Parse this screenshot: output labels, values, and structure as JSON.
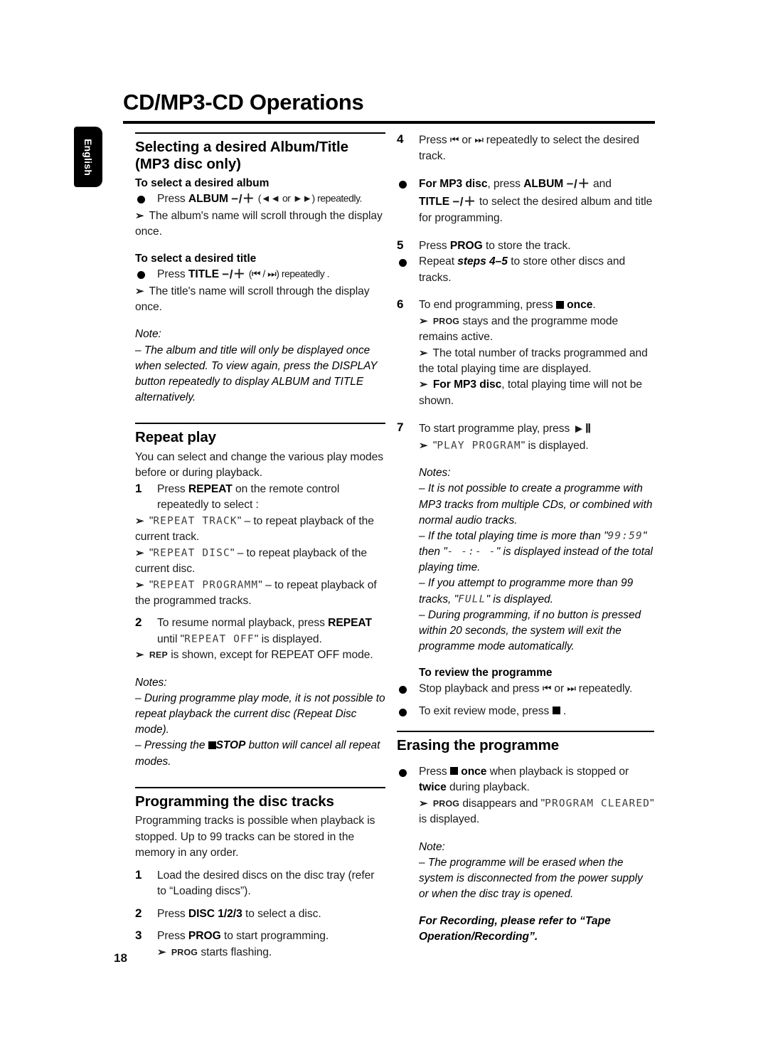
{
  "header": {
    "title": "CD/MP3-CD Operations",
    "language_tab": "English"
  },
  "page_number": "18",
  "left_column": {
    "section1": {
      "title": "Selecting a desired Album/Title (MP3 disc only)",
      "sub1_title": "To select a desired album",
      "sub1_press": "Press",
      "sub1_button": "ALBUM",
      "sub1_pm": "−/＋",
      "sub1_glyphs": "(◄◄ or ►►) repeatedly.",
      "sub1_result": "The album's name will scroll through the display once.",
      "sub2_title": "To select a desired title",
      "sub2_press": "Press",
      "sub2_button": "TITLE",
      "sub2_pm": "−/＋",
      "sub2_glyphs": "(⏮ / ⏭) repeatedly .",
      "sub2_result": "The title's name will scroll through the display once.",
      "note_label": "Note:",
      "note_text": "–  The album and title will only be displayed once when selected. To view again, press the DISPLAY button repeatedly to display ALBUM and TITLE alternatively."
    },
    "section2": {
      "title": "Repeat play",
      "intro": "You can select and change the various play modes before or during playback.",
      "step1_num": "1",
      "step1_a": "Press",
      "step1_button": "REPEAT",
      "step1_b": "on the remote control repeatedly to select :",
      "step1_r1_lcd": "REPEAT TRACK",
      "step1_r1_text": "– to repeat playback of the current track.",
      "step1_r2_lcd": "REPEAT DISC",
      "step1_r2_text": "– to repeat playback of the current disc.",
      "step1_r3_lcd": "REPEAT PROGRAMM",
      "step1_r3_text": "– to repeat playback of the programmed tracks.",
      "step2_num": "2",
      "step2_a": "To resume normal playback, press",
      "step2_button": "REPEAT",
      "step2_b": "until",
      "step2_lcd": "REPEAT OFF",
      "step2_c": "is displayed.",
      "step2_result_ind": "REP",
      "step2_result_text": "is shown, except for REPEAT OFF mode.",
      "notes_label": "Notes:",
      "note1": "–  During programme play mode, it is not possible to repeat playback the current disc (Repeat Disc mode).",
      "note2_a": "–  Pressing the",
      "note2_button": "STOP",
      "note2_b": "button will cancel all repeat modes."
    },
    "section3": {
      "title": "Programming the disc tracks",
      "intro": "Programming tracks is possible when playback is stopped. Up to 99 tracks can be stored in the memory in any order.",
      "step1_num": "1",
      "step1_text": "Load the desired discs on the disc tray (refer to “Loading discs”).",
      "step2_num": "2",
      "step2_a": "Press",
      "step2_button": "DISC 1/2/3",
      "step2_b": "to select a disc.",
      "step3_num": "3",
      "step3_a": "Press",
      "step3_button": "PROG",
      "step3_b": "to start programming.",
      "step3_result_ind": "PROG",
      "step3_result_text": "starts flashing."
    }
  },
  "right_column": {
    "step4": {
      "num": "4",
      "a": "Press",
      "glyph1": "⏮",
      "mid": "or",
      "glyph2": "⏭",
      "b": "repeatedly to select the desired track."
    },
    "bullet_mp3": {
      "a": "For MP3 disc",
      "b": ", press",
      "button1": "ALBUM",
      "pm1": "−/＋",
      "c": "and",
      "button2": "TITLE",
      "pm2": "−/＋",
      "d": "to select the desired album and title for programming."
    },
    "step5": {
      "num": "5",
      "a": "Press",
      "button": "PROG",
      "b": "to store the track.",
      "bullet_a": "Repeat",
      "bullet_steps": "steps 4–5",
      "bullet_b": "to store other discs and tracks."
    },
    "step6": {
      "num": "6",
      "a": "To end programming, press",
      "b": "once",
      "c": ".",
      "r1_ind": "PROG",
      "r1_text": "stays and the programme mode remains active.",
      "r2_text": "The total number of tracks programmed and the total playing time are displayed.",
      "r3_a": "For MP3 disc",
      "r3_b": ", total playing time will not be shown."
    },
    "step7": {
      "num": "7",
      "a": "To start programme play, press",
      "glyph": "►Ⅱ",
      "r_lcd": "PLAY PROGRAM",
      "r_text": "is displayed."
    },
    "notes": {
      "label": "Notes:",
      "note1": "–  It is not possible to create a programme with MP3 tracks from multiple CDs, or combined with normal audio tracks.",
      "note2_a": "–  If the total playing time is more than \"",
      "note2_lcd1": "99:59",
      "note2_b": "\" then \"",
      "note2_lcd2": "- -:- -",
      "note2_c": "\" is displayed instead of the total playing time.",
      "note3_a": "–  If you attempt to programme more than 99 tracks, \"",
      "note3_lcd": "FULL",
      "note3_b": "\" is displayed.",
      "note4": "–  During programming, if no button is pressed within 20 seconds, the system will exit the programme mode automatically."
    },
    "review": {
      "title": "To review the programme",
      "b1_a": "Stop playback and press",
      "b1_glyph1": "⏮",
      "b1_mid": "or",
      "b1_glyph2": "⏭",
      "b1_b": "repeatedly.",
      "b2_a": "To exit review mode, press",
      "b2_b": "."
    },
    "erasing": {
      "title": "Erasing the programme",
      "b1_a": "Press",
      "b1_b": "once",
      "b1_c": "when playback is stopped or",
      "b1_d": "twice",
      "b1_e": "during playback.",
      "r_ind": "PROG",
      "r_a": "disappears and \"",
      "r_lcd": "PROGRAM CLEARED",
      "r_b": "\" is displayed.",
      "note_label": "Note:",
      "note_text": "–  The programme will be erased when the system is disconnected from the power supply or when the disc tray is opened."
    },
    "footnote": "For Recording, please refer to “Tape Operation/Recording”."
  }
}
